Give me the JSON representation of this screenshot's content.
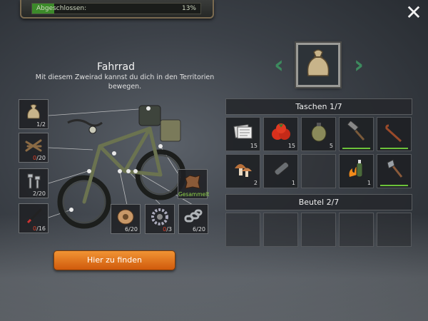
{
  "progress": {
    "label": "Abgeschlossen:",
    "percent_text": "13%",
    "fraction": 0.13
  },
  "close_label": "✕",
  "item": {
    "title": "Fahrrad",
    "description": "Mit diesem Zweirad kannst du dich in den Territorien bewegen."
  },
  "parts": [
    {
      "name": "sack",
      "have": "1",
      "need": "/2"
    },
    {
      "name": "wooden-sticks",
      "have": "0",
      "need": "/20"
    },
    {
      "name": "bolts",
      "have": "2",
      "need": "/20"
    },
    {
      "name": "metal-rod",
      "have": "0",
      "need": "/16"
    },
    {
      "name": "leather",
      "done": "Gesammelt"
    },
    {
      "name": "rope-spool",
      "have": "6",
      "need": "/20"
    },
    {
      "name": "gear",
      "have": "0",
      "need": "/3"
    },
    {
      "name": "chain",
      "have": "6",
      "need": "/20"
    }
  ],
  "find_button": "Hier zu finden",
  "nav": {
    "prev": "‹",
    "next": "›"
  },
  "inventory": {
    "pockets": {
      "title": "Taschen 1/7"
    },
    "bag": {
      "title": "Beutel 2/7"
    },
    "items": [
      {
        "name": "newspapers",
        "qty": "15"
      },
      {
        "name": "tomatoes",
        "qty": "15"
      },
      {
        "name": "canteen",
        "qty": "5"
      },
      {
        "name": "hammer",
        "qty": ""
      },
      {
        "name": "crowbar",
        "qty": ""
      },
      {
        "name": "mushrooms",
        "qty": "2"
      },
      {
        "name": "pipe",
        "qty": "1"
      },
      {
        "name": "empty",
        "qty": ""
      },
      {
        "name": "molotov",
        "qty": "1"
      },
      {
        "name": "axe",
        "qty": ""
      }
    ]
  },
  "colors": {
    "accent": "#e07a1c",
    "ok": "#8ed24a",
    "missing": "#e0402a",
    "arrow": "#3d8a5e"
  }
}
